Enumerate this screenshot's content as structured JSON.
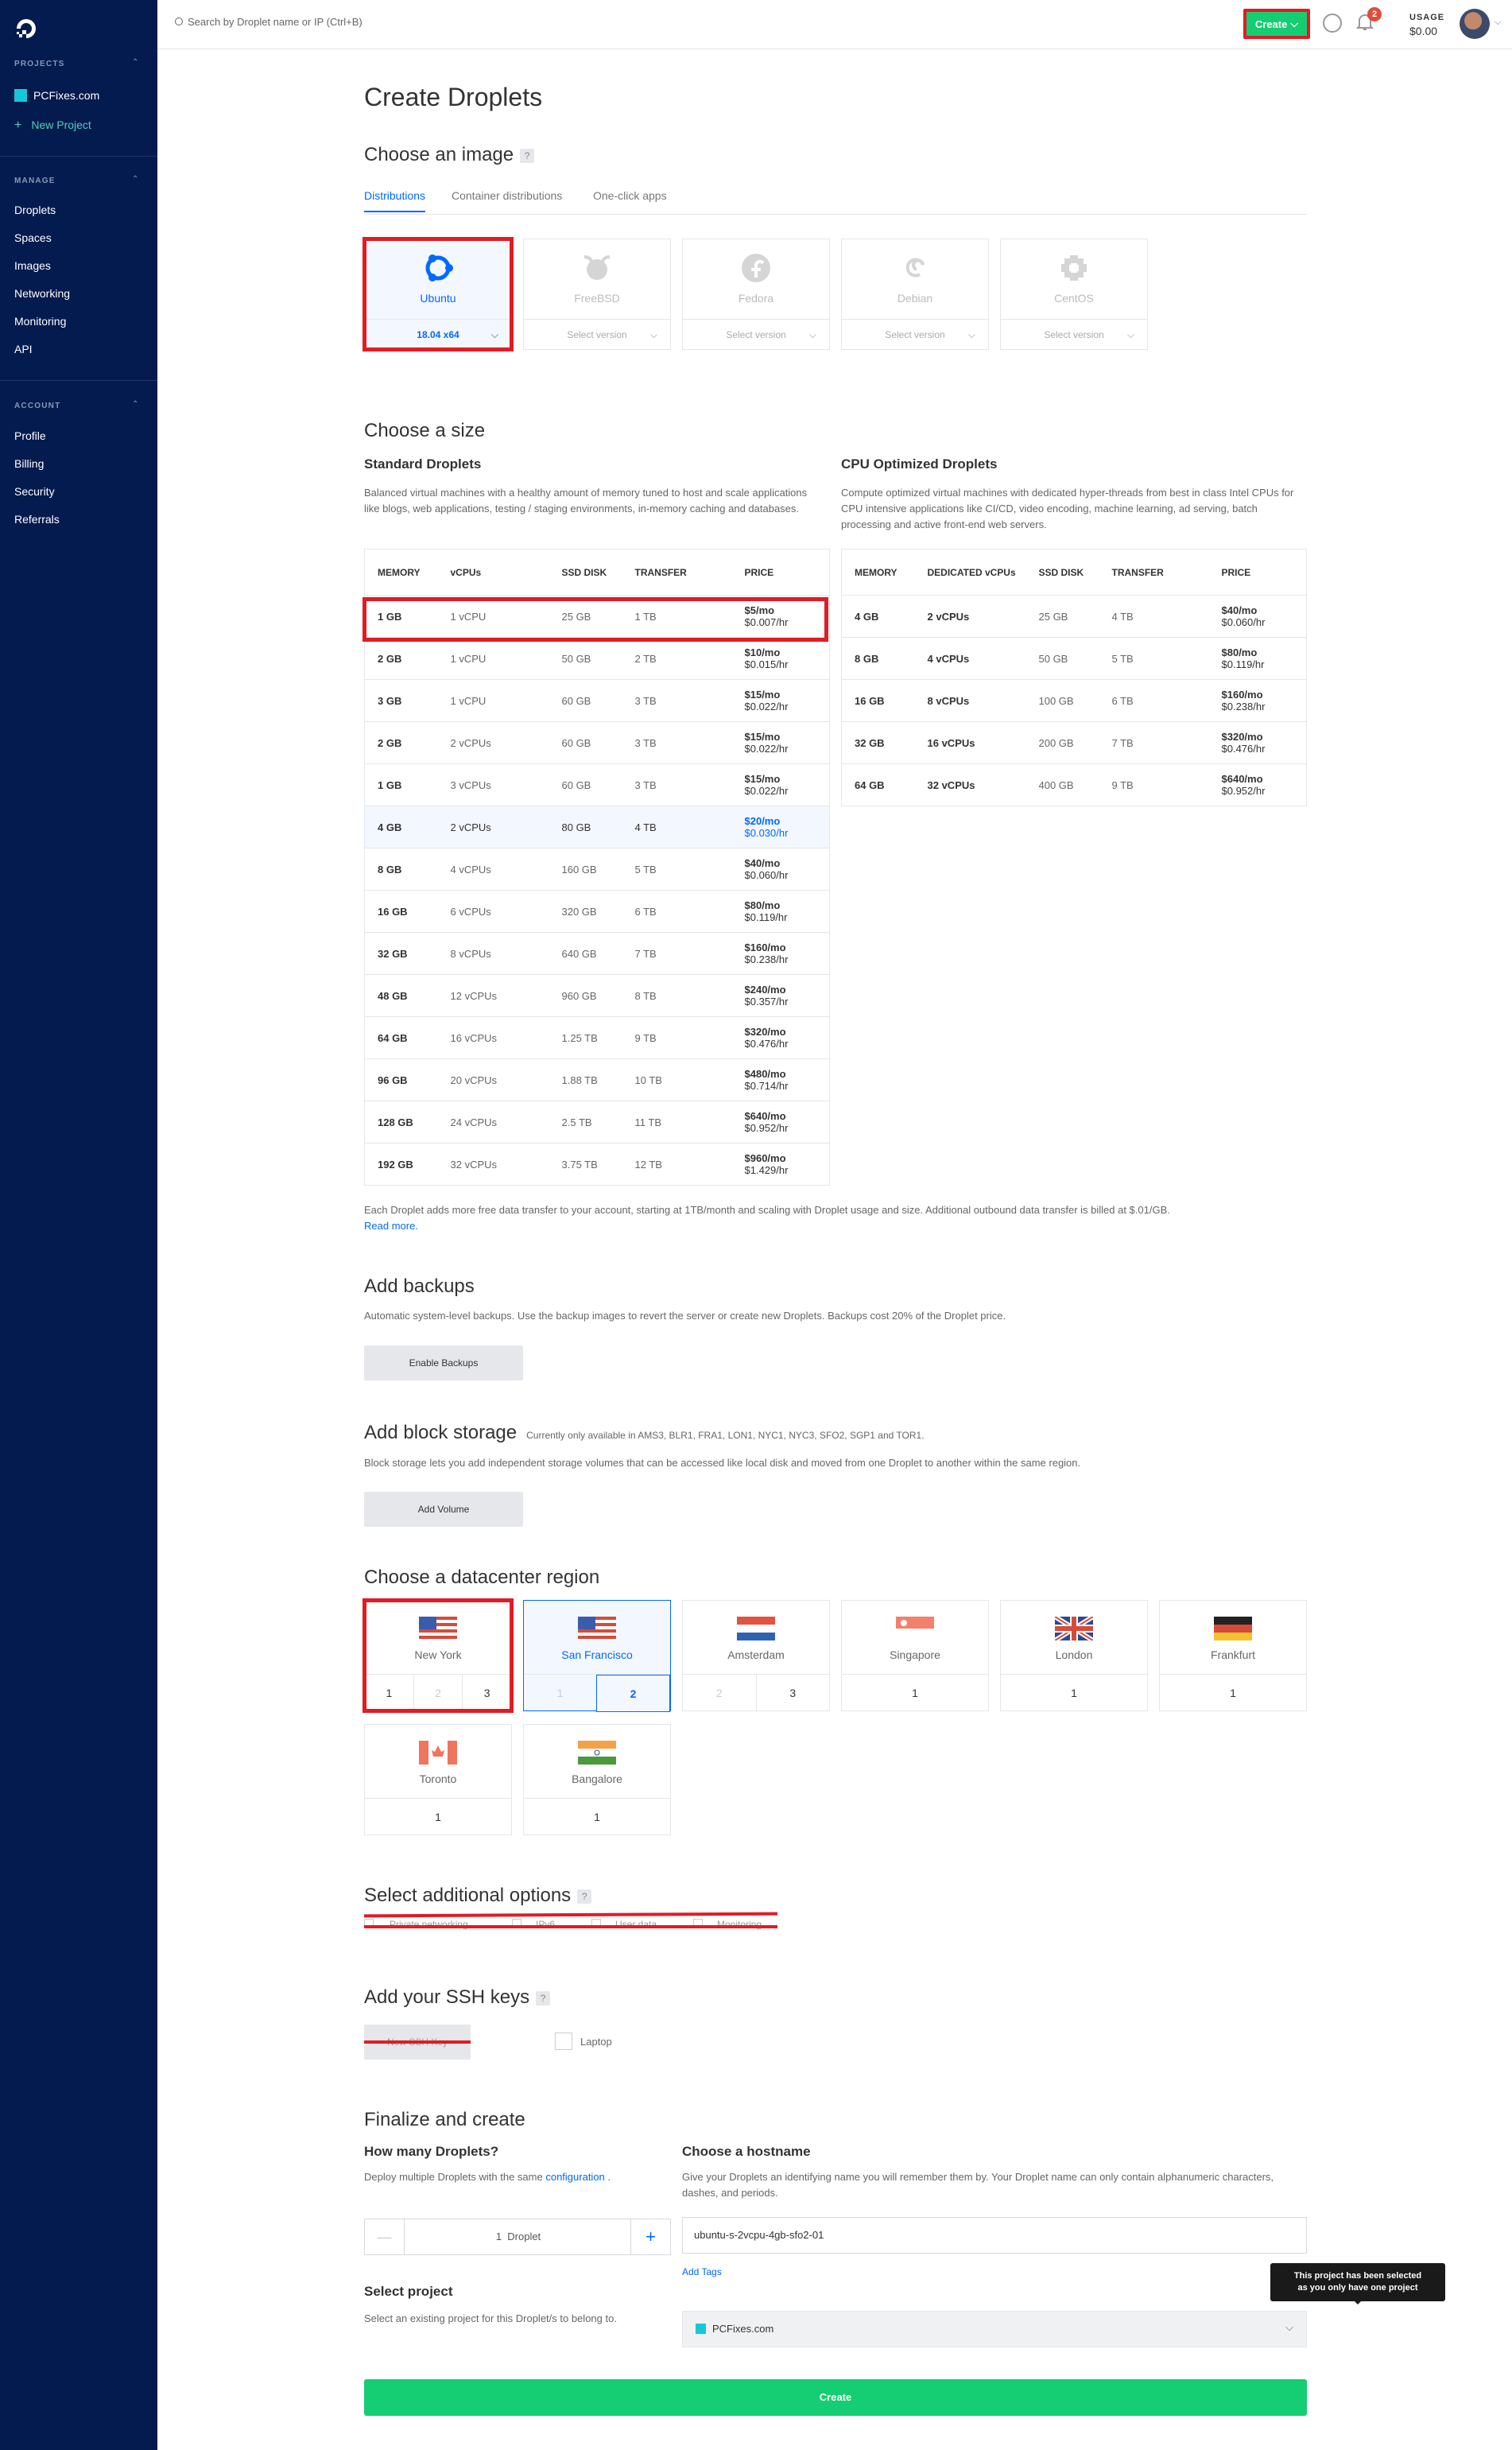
{
  "sidebar": {
    "projects_header": "PROJECTS",
    "project_name": "PCFixes.com",
    "new_project": "New Project",
    "manage_header": "MANAGE",
    "manage_items": [
      "Droplets",
      "Spaces",
      "Images",
      "Networking",
      "Monitoring",
      "API"
    ],
    "account_header": "ACCOUNT",
    "account_items": [
      "Profile",
      "Billing",
      "Security",
      "Referrals"
    ]
  },
  "topbar": {
    "search_placeholder": "Search by Droplet name or IP (Ctrl+B)",
    "create_label": "Create",
    "notification_count": "2",
    "usage_label": "USAGE",
    "usage_value": "$0.00"
  },
  "page_title": "Create Droplets",
  "image": {
    "heading": "Choose an image",
    "help": "?",
    "tabs": [
      "Distributions",
      "Container distributions",
      "One-click apps"
    ],
    "distros": [
      {
        "name": "Ubuntu",
        "version": "18.04 x64",
        "selected": true
      },
      {
        "name": "FreeBSD",
        "version": "Select version",
        "selected": false
      },
      {
        "name": "Fedora",
        "version": "Select version",
        "selected": false
      },
      {
        "name": "Debian",
        "version": "Select version",
        "selected": false
      },
      {
        "name": "CentOS",
        "version": "Select version",
        "selected": false
      }
    ]
  },
  "size": {
    "heading": "Choose a size",
    "standard_title": "Standard Droplets",
    "standard_desc": "Balanced virtual machines with a healthy amount of memory tuned to host and scale applications like blogs, web applications, testing / staging environments, in-memory caching and databases.",
    "standard_cols": [
      "MEMORY",
      "vCPUs",
      "SSD DISK",
      "TRANSFER",
      "PRICE"
    ],
    "standard_rows": [
      {
        "mem": "1 GB",
        "cpu": "1 vCPU",
        "disk": "25 GB",
        "transfer": "1 TB",
        "mo": "$5/mo",
        "hr": "$0.007/hr"
      },
      {
        "mem": "2 GB",
        "cpu": "1 vCPU",
        "disk": "50 GB",
        "transfer": "2 TB",
        "mo": "$10/mo",
        "hr": "$0.015/hr"
      },
      {
        "mem": "3 GB",
        "cpu": "1 vCPU",
        "disk": "60 GB",
        "transfer": "3 TB",
        "mo": "$15/mo",
        "hr": "$0.022/hr"
      },
      {
        "mem": "2 GB",
        "cpu": "2 vCPUs",
        "disk": "60 GB",
        "transfer": "3 TB",
        "mo": "$15/mo",
        "hr": "$0.022/hr"
      },
      {
        "mem": "1 GB",
        "cpu": "3 vCPUs",
        "disk": "60 GB",
        "transfer": "3 TB",
        "mo": "$15/mo",
        "hr": "$0.022/hr"
      },
      {
        "mem": "4 GB",
        "cpu": "2 vCPUs",
        "disk": "80 GB",
        "transfer": "4 TB",
        "mo": "$20/mo",
        "hr": "$0.030/hr",
        "selected": true
      },
      {
        "mem": "8 GB",
        "cpu": "4 vCPUs",
        "disk": "160 GB",
        "transfer": "5 TB",
        "mo": "$40/mo",
        "hr": "$0.060/hr"
      },
      {
        "mem": "16 GB",
        "cpu": "6 vCPUs",
        "disk": "320 GB",
        "transfer": "6 TB",
        "mo": "$80/mo",
        "hr": "$0.119/hr"
      },
      {
        "mem": "32 GB",
        "cpu": "8 vCPUs",
        "disk": "640 GB",
        "transfer": "7 TB",
        "mo": "$160/mo",
        "hr": "$0.238/hr"
      },
      {
        "mem": "48 GB",
        "cpu": "12 vCPUs",
        "disk": "960 GB",
        "transfer": "8 TB",
        "mo": "$240/mo",
        "hr": "$0.357/hr"
      },
      {
        "mem": "64 GB",
        "cpu": "16 vCPUs",
        "disk": "1.25 TB",
        "transfer": "9 TB",
        "mo": "$320/mo",
        "hr": "$0.476/hr"
      },
      {
        "mem": "96 GB",
        "cpu": "20 vCPUs",
        "disk": "1.88 TB",
        "transfer": "10 TB",
        "mo": "$480/mo",
        "hr": "$0.714/hr"
      },
      {
        "mem": "128 GB",
        "cpu": "24 vCPUs",
        "disk": "2.5 TB",
        "transfer": "11 TB",
        "mo": "$640/mo",
        "hr": "$0.952/hr"
      },
      {
        "mem": "192 GB",
        "cpu": "32 vCPUs",
        "disk": "3.75 TB",
        "transfer": "12 TB",
        "mo": "$960/mo",
        "hr": "$1.429/hr"
      }
    ],
    "cpu_title": "CPU Optimized Droplets",
    "cpu_desc": "Compute optimized virtual machines with dedicated hyper-threads from best in class Intel CPUs for CPU intensive applications like CI/CD, video encoding, machine learning, ad serving, batch processing and active front-end web servers.",
    "cpu_cols": [
      "MEMORY",
      "DEDICATED vCPUs",
      "SSD DISK",
      "TRANSFER",
      "PRICE"
    ],
    "cpu_rows": [
      {
        "mem": "4 GB",
        "cpu": "2 vCPUs",
        "disk": "25 GB",
        "transfer": "4 TB",
        "mo": "$40/mo",
        "hr": "$0.060/hr"
      },
      {
        "mem": "8 GB",
        "cpu": "4 vCPUs",
        "disk": "50 GB",
        "transfer": "5 TB",
        "mo": "$80/mo",
        "hr": "$0.119/hr"
      },
      {
        "mem": "16 GB",
        "cpu": "8 vCPUs",
        "disk": "100 GB",
        "transfer": "6 TB",
        "mo": "$160/mo",
        "hr": "$0.238/hr"
      },
      {
        "mem": "32 GB",
        "cpu": "16 vCPUs",
        "disk": "200 GB",
        "transfer": "7 TB",
        "mo": "$320/mo",
        "hr": "$0.476/hr"
      },
      {
        "mem": "64 GB",
        "cpu": "32 vCPUs",
        "disk": "400 GB",
        "transfer": "9 TB",
        "mo": "$640/mo",
        "hr": "$0.952/hr"
      }
    ],
    "footnote": "Each Droplet adds more free data transfer to your account, starting at 1TB/month and scaling with Droplet usage and size. Additional outbound data transfer is billed at $.01/GB.",
    "read_more": "Read more."
  },
  "backups": {
    "heading": "Add backups",
    "desc": "Automatic system-level backups. Use the backup images to revert the server or create new Droplets. Backups cost 20% of the Droplet price.",
    "button": "Enable Backups"
  },
  "block_storage": {
    "heading": "Add block storage",
    "availability": "Currently only available in AMS3, BLR1, FRA1, LON1, NYC1, NYC3, SFO2, SGP1 and TOR1.",
    "desc": "Block storage lets you add independent storage volumes that can be accessed like local disk and moved from one Droplet to another within the same region.",
    "button": "Add Volume"
  },
  "region": {
    "heading": "Choose a datacenter region",
    "regions": [
      {
        "name": "New York",
        "nums": [
          "1",
          "2",
          "3"
        ]
      },
      {
        "name": "San Francisco",
        "nums": [
          "1",
          "2"
        ]
      },
      {
        "name": "Amsterdam",
        "nums": [
          "2",
          "3"
        ]
      },
      {
        "name": "Singapore",
        "nums": [
          "1"
        ]
      },
      {
        "name": "London",
        "nums": [
          "1"
        ]
      },
      {
        "name": "Frankfurt",
        "nums": [
          "1"
        ]
      },
      {
        "name": "Toronto",
        "nums": [
          "1"
        ]
      },
      {
        "name": "Bangalore",
        "nums": [
          "1"
        ]
      }
    ]
  },
  "options": {
    "heading": "Select additional options",
    "items": [
      "Private networking",
      "IPv6",
      "User data",
      "Monitoring"
    ]
  },
  "ssh": {
    "heading": "Add your SSH keys",
    "new_key": "New SSH Key",
    "key_name": "Laptop"
  },
  "finalize": {
    "heading": "Finalize and create",
    "count_title": "How many Droplets?",
    "count_desc_prefix": "Deploy multiple Droplets with the same",
    "count_desc_link": "configuration",
    "count_value": "1  Droplet",
    "hostname_title": "Choose a hostname",
    "hostname_desc": "Give your Droplets an identifying name you will remember them by. Your Droplet name can only contain alphanumeric characters, dashes, and periods.",
    "hostname_value": "ubuntu-s-2vcpu-4gb-sfo2-01",
    "add_tags": "Add Tags",
    "project_title": "Select project",
    "project_desc": "Select an existing project for this Droplet/s to belong to.",
    "project_value": "PCFixes.com",
    "tooltip_line1": "This project has been selected",
    "tooltip_line2": "as you only have one project",
    "create_button": "Create"
  }
}
